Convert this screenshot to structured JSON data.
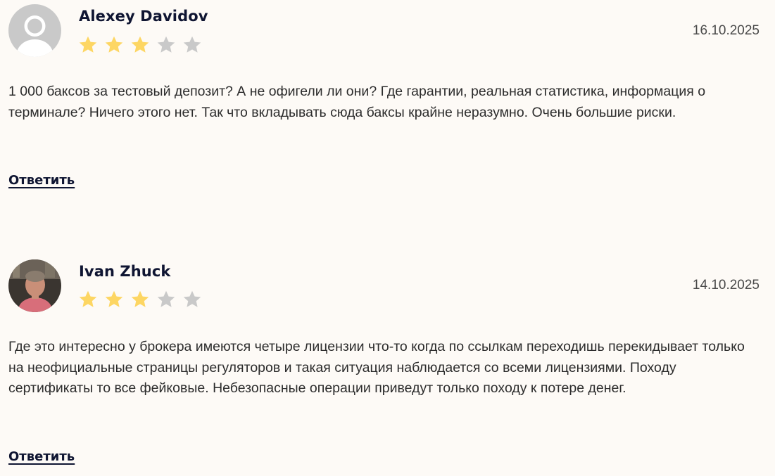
{
  "reviews": [
    {
      "author": "Alexey Davidov",
      "date": "16.10.2025",
      "rating": 3,
      "max_rating": 5,
      "avatar": "default-user-avatar",
      "text": "1 000 баксов за тестовый депозит? А не офигели ли они? Где гарантии, реальная статистика, информация о терминале? Ничего этого нет. Так что вкладывать сюда баксы крайне неразумно. Очень большие риски.",
      "reply_label": "Ответить"
    },
    {
      "author": "Ivan Zhuck",
      "date": "14.10.2025",
      "rating": 3,
      "max_rating": 5,
      "avatar": "user-photo-avatar",
      "text": "Где это интересно у брокера имеются четыре лицензии что-то когда по ссылкам переходишь перекидывает только на неофициальные страницы регуляторов и такая ситуация наблюдается со всеми лицензиями. Походу сертификаты то все фейковые. Небезопасные операции приведут только походу к потере денег.",
      "reply_label": "Ответить"
    }
  ],
  "colors": {
    "star_filled": "#fdd663",
    "star_empty": "#c9c9c9",
    "author": "#0f1532",
    "background": "#fdfaf6"
  },
  "icons": {
    "star": "star-icon"
  }
}
